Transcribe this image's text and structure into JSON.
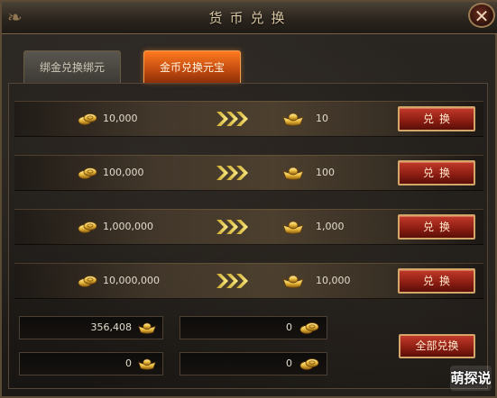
{
  "window": {
    "title": "货币兑换",
    "close_symbol": "✕"
  },
  "tabs": [
    {
      "label": "绑金兑换绑元",
      "active": false
    },
    {
      "label": "金币兑换元宝",
      "active": true
    }
  ],
  "rows": [
    {
      "from_amount": "10,000",
      "to_amount": "10",
      "button_label": "兑换"
    },
    {
      "from_amount": "100,000",
      "to_amount": "100",
      "button_label": "兑换"
    },
    {
      "from_amount": "1,000,000",
      "to_amount": "1,000",
      "button_label": "兑换"
    },
    {
      "from_amount": "10,000,000",
      "to_amount": "10,000",
      "button_label": "兑换"
    }
  ],
  "balances": {
    "ingot_balance": "356,408",
    "coin_balance": "0",
    "bound_ingot_balance": "0",
    "bound_coin_balance": "0"
  },
  "all_exchange_label": "全部兑换",
  "watermark": "萌探说",
  "colors": {
    "accent_orange": "#e8641a",
    "button_red": "#a02818",
    "gold": "#e8c24a",
    "text": "#e2dccc"
  },
  "icons": {
    "coin": "gold-coins-icon",
    "ingot": "gold-ingot-icon",
    "arrow": "triple-chevron-arrow-icon",
    "close": "close-icon"
  }
}
